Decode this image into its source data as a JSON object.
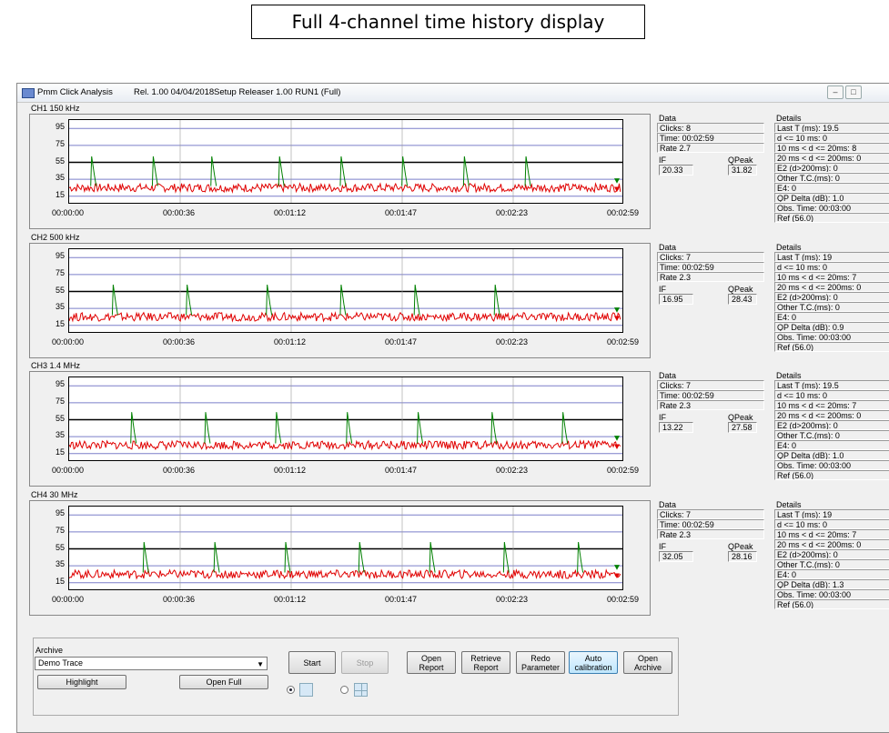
{
  "caption": "Full 4-channel time history display",
  "window": {
    "app_title": "Pmm Click Analysis",
    "release": "Rel. 1.00 04/04/2018",
    "setup": "Setup Releaser 1.00 RUN1 (Full)"
  },
  "y_ticks": [
    "95",
    "75",
    "55",
    "35",
    "15"
  ],
  "x_ticks": [
    "00:00:00",
    "00:00:36",
    "00:01:12",
    "00:01:47",
    "00:02:23",
    "00:02:59"
  ],
  "labels": {
    "data": "Data",
    "details": "Details",
    "if": "IF",
    "qpeak": "QPeak"
  },
  "channels": [
    {
      "name": "CH1 150 kHz",
      "data": {
        "clicks": "Clicks: 8",
        "time": "Time: 00:02:59",
        "rate": "Rate 2.7"
      },
      "if_value": "20.33",
      "qpeak_value": "31.82",
      "details": [
        "Last T (ms): 19.5",
        "d <= 10 ms: 0",
        "10 ms < d <= 20ms: 8",
        "20 ms < d <= 200ms: 0",
        "E2 (d>200ms): 0",
        "Other T.C.(ms): 0",
        "E4: 0",
        "QP Delta (dB): 1.0",
        "Obs. Time: 00:03:00",
        "Ref (56.0)"
      ]
    },
    {
      "name": "CH2 500 kHz",
      "data": {
        "clicks": "Clicks: 7",
        "time": "Time: 00:02:59",
        "rate": "Rate 2.3"
      },
      "if_value": "16.95",
      "qpeak_value": "28.43",
      "details": [
        "Last T (ms): 19",
        "d <= 10 ms: 0",
        "10 ms < d <= 20ms: 7",
        "20 ms < d <= 200ms: 0",
        "E2 (d>200ms): 0",
        "Other T.C.(ms): 0",
        "E4: 0",
        "QP Delta (dB): 0.9",
        "Obs. Time: 00:03:00",
        "Ref (56.0)"
      ]
    },
    {
      "name": "CH3 1.4 MHz",
      "data": {
        "clicks": "Clicks: 7",
        "time": "Time: 00:02:59",
        "rate": "Rate 2.3"
      },
      "if_value": "13.22",
      "qpeak_value": "27.58",
      "details": [
        "Last T (ms): 19.5",
        "d <= 10 ms: 0",
        "10 ms < d <= 20ms: 7",
        "20 ms < d <= 200ms: 0",
        "E2 (d>200ms): 0",
        "Other T.C.(ms): 0",
        "E4: 0",
        "QP Delta (dB): 1.0",
        "Obs. Time: 00:03:00",
        "Ref (56.0)"
      ]
    },
    {
      "name": "CH4 30 MHz",
      "data": {
        "clicks": "Clicks: 7",
        "time": "Time: 00:02:59",
        "rate": "Rate 2.3"
      },
      "if_value": "32.05",
      "qpeak_value": "28.16",
      "details": [
        "Last T (ms): 19",
        "d <= 10 ms: 0",
        "10 ms < d <= 20ms: 7",
        "20 ms < d <= 200ms: 0",
        "E2 (d>200ms): 0",
        "Other T.C.(ms): 0",
        "E4: 0",
        "QP Delta (dB): 1.3",
        "Obs. Time: 00:03:00",
        "Ref (56.0)"
      ]
    }
  ],
  "chart_data": [
    {
      "type": "line",
      "ylim": [
        5,
        105
      ],
      "yticks": [
        95,
        75,
        55,
        35,
        15
      ],
      "reference_line": 55,
      "baseline_range": [
        20,
        30
      ],
      "click_times_s": [
        7,
        27,
        46,
        68,
        88,
        108,
        128,
        148
      ],
      "click_peaks": [
        62,
        62,
        62,
        62,
        62,
        62,
        62,
        62
      ],
      "colors": {
        "trace": "#e00000",
        "click": "#008000",
        "grid": "#7b7fc9"
      }
    },
    {
      "type": "line",
      "ylim": [
        5,
        105
      ],
      "yticks": [
        95,
        75,
        55,
        35,
        15
      ],
      "reference_line": 55,
      "baseline_range": [
        20,
        30
      ],
      "click_times_s": [
        14,
        38,
        64,
        88,
        112,
        138
      ],
      "click_peaks": [
        63,
        63,
        63,
        63,
        63,
        63
      ],
      "colors": {
        "trace": "#e00000",
        "click": "#008000",
        "grid": "#7b7fc9"
      }
    },
    {
      "type": "line",
      "ylim": [
        5,
        105
      ],
      "yticks": [
        95,
        75,
        55,
        35,
        15
      ],
      "reference_line": 55,
      "baseline_range": [
        20,
        30
      ],
      "click_times_s": [
        20,
        44,
        67,
        90,
        113,
        137,
        160
      ],
      "click_peaks": [
        64,
        64,
        64,
        64,
        64,
        64,
        64
      ],
      "colors": {
        "trace": "#e00000",
        "click": "#008000",
        "grid": "#7b7fc9"
      }
    },
    {
      "type": "line",
      "ylim": [
        5,
        105
      ],
      "yticks": [
        95,
        75,
        55,
        35,
        15
      ],
      "reference_line": 55,
      "baseline_range": [
        20,
        30
      ],
      "click_times_s": [
        24,
        47,
        70,
        94,
        117,
        141,
        165
      ],
      "click_peaks": [
        63,
        63,
        63,
        63,
        63,
        63,
        63
      ],
      "colors": {
        "trace": "#e00000",
        "click": "#008000",
        "grid": "#7b7fc9"
      }
    }
  ],
  "controls": {
    "archive_label": "Archive",
    "archive_value": "Demo Trace",
    "highlight": "Highlight",
    "open_full": "Open Full",
    "start": "Start",
    "stop": "Stop",
    "open_report": "Open\nReport",
    "retrieve_report": "Retrieve\nReport",
    "redo_parameter": "Redo\nParameter",
    "auto_calibration": "Auto\ncalibration",
    "open_archive": "Open\nArchive"
  }
}
